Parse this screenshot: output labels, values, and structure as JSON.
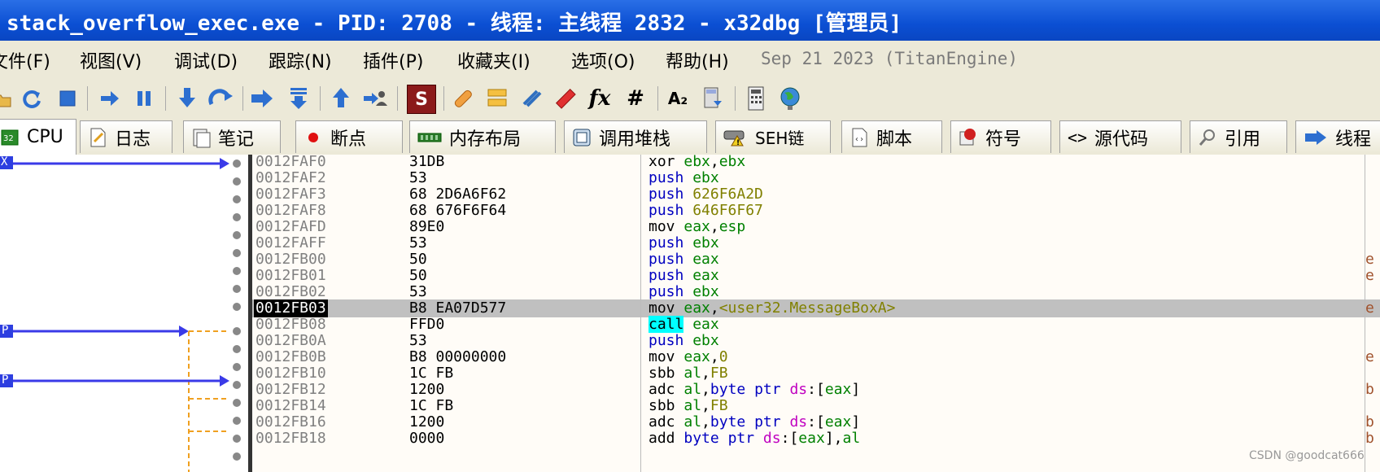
{
  "window": {
    "title": "stack_overflow_exec.exe - PID: 2708 - 线程: 主线程 2832 - x32dbg [管理员]"
  },
  "menu": {
    "items": [
      "文件(F)",
      "视图(V)",
      "调试(D)",
      "跟踪(N)",
      "插件(P)",
      "收藏夹(I)",
      "选项(O)",
      "帮助(H)"
    ],
    "version": "Sep 21 2023 (TitanEngine)"
  },
  "toolbar": {
    "icons": [
      "open-icon",
      "restart-icon",
      "stop-icon",
      "run-icon",
      "pause-icon",
      "step-into-icon",
      "step-over-icon",
      "run-to-icon",
      "step-down-icon",
      "execute-till-return-icon",
      "run-to-user-icon",
      "script-icon",
      "patch-icon",
      "comment-icon",
      "label-icon",
      "bookmark-icon",
      "function-icon",
      "hash-icon",
      "font-icon",
      "calculator-icon",
      "favorites-icon",
      "globe-icon"
    ],
    "fx_label": "fx",
    "hash_label": "#",
    "font_label": "A₂"
  },
  "tabs": [
    {
      "label": "CPU",
      "icon": "cpu-icon"
    },
    {
      "label": "日志",
      "icon": "log-icon"
    },
    {
      "label": "笔记",
      "icon": "notes-icon"
    },
    {
      "label": "断点",
      "icon": "breakpoint-icon"
    },
    {
      "label": "内存布局",
      "icon": "memory-icon"
    },
    {
      "label": "调用堆栈",
      "icon": "callstack-icon"
    },
    {
      "label": "SEH链",
      "icon": "seh-icon"
    },
    {
      "label": "脚本",
      "icon": "script-icon"
    },
    {
      "label": "符号",
      "icon": "symbol-icon"
    },
    {
      "label": "源代码",
      "icon": "source-icon"
    },
    {
      "label": "引用",
      "icon": "search-icon"
    },
    {
      "label": "线程",
      "icon": "thread-icon"
    }
  ],
  "left_markers": {
    "x_marker": "X",
    "p_marker_1": "P",
    "p_marker_2": "P"
  },
  "disasm": {
    "rows": [
      {
        "addr": "0012FAF0",
        "bytes": "31DB",
        "mn": "xor",
        "ops": "ebx,ebx",
        "cmt": ""
      },
      {
        "addr": "0012FAF2",
        "bytes": "53",
        "mn": "push",
        "ops": "ebx",
        "cmt": ""
      },
      {
        "addr": "0012FAF3",
        "bytes": "68 2D6A6F62",
        "mn": "push",
        "ops": "626F6A2D",
        "cmt": ""
      },
      {
        "addr": "0012FAF8",
        "bytes": "68 676F6F64",
        "mn": "push",
        "ops": "646F6F67",
        "cmt": ""
      },
      {
        "addr": "0012FAFD",
        "bytes": "89E0",
        "mn": "mov",
        "ops": "eax,esp",
        "cmt": ""
      },
      {
        "addr": "0012FAFF",
        "bytes": "53",
        "mn": "push",
        "ops": "ebx",
        "cmt": ""
      },
      {
        "addr": "0012FB00",
        "bytes": "50",
        "mn": "push",
        "ops": "eax",
        "cmt": "e"
      },
      {
        "addr": "0012FB01",
        "bytes": "50",
        "mn": "push",
        "ops": "eax",
        "cmt": "e"
      },
      {
        "addr": "0012FB02",
        "bytes": "53",
        "mn": "push",
        "ops": "ebx",
        "cmt": ""
      },
      {
        "addr": "0012FB03",
        "bytes": "B8 EA07D577",
        "mn": "mov",
        "ops": "eax,<user32.MessageBoxA>",
        "cmt": "e"
      },
      {
        "addr": "0012FB08",
        "bytes": "FFD0",
        "mn": "call",
        "ops": "eax",
        "cmt": ""
      },
      {
        "addr": "0012FB0A",
        "bytes": "53",
        "mn": "push",
        "ops": "ebx",
        "cmt": ""
      },
      {
        "addr": "0012FB0B",
        "bytes": "B8 00000000",
        "mn": "mov",
        "ops": "eax,0",
        "cmt": "e"
      },
      {
        "addr": "0012FB10",
        "bytes": "1C FB",
        "mn": "sbb",
        "ops": "al,FB",
        "cmt": ""
      },
      {
        "addr": "0012FB12",
        "bytes": "1200",
        "mn": "adc",
        "ops": "al,byte ptr ds:[eax]",
        "cmt": "b"
      },
      {
        "addr": "0012FB14",
        "bytes": "1C FB",
        "mn": "sbb",
        "ops": "al,FB",
        "cmt": ""
      },
      {
        "addr": "0012FB16",
        "bytes": "1200",
        "mn": "adc",
        "ops": "al,byte ptr ds:[eax]",
        "cmt": "b"
      },
      {
        "addr": "0012FB18",
        "bytes": "0000",
        "mn": "add",
        "ops": "byte ptr ds:[eax],al",
        "cmt": "b"
      }
    ]
  },
  "watermark": "CSDN @goodcat666"
}
